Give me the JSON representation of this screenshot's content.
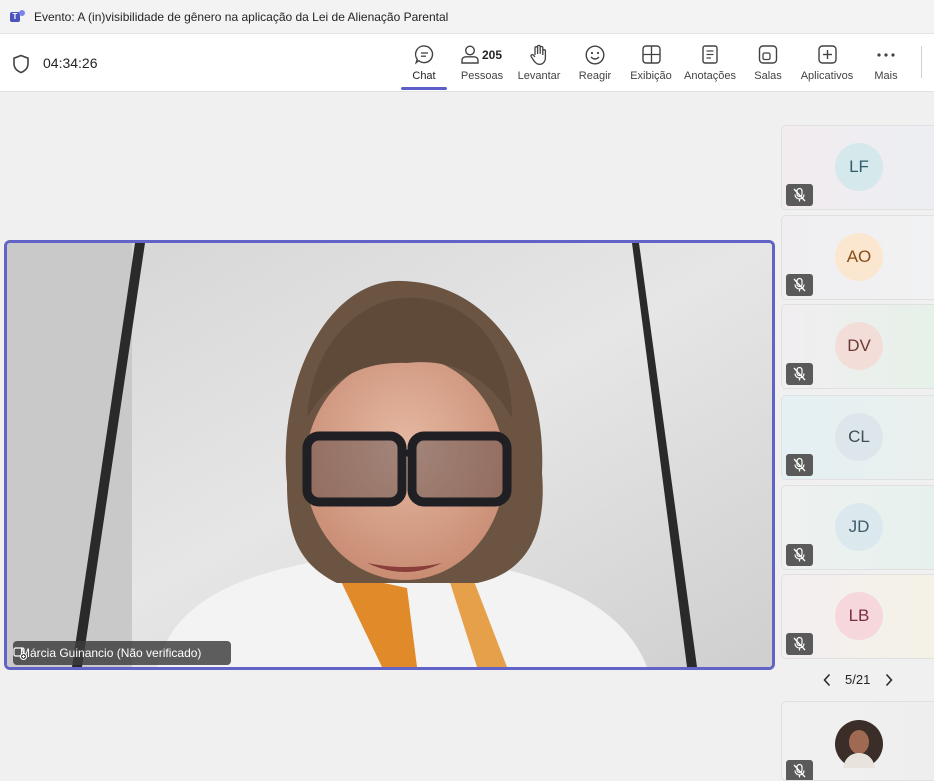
{
  "window": {
    "title": "Evento: A (in)visibilidade de gênero na aplicação da Lei de Alienação Parental"
  },
  "toolbar": {
    "timer": "04:34:26",
    "people_count": "205",
    "buttons": {
      "chat": "Chat",
      "people": "Pessoas",
      "raise": "Levantar",
      "react": "Reagir",
      "view": "Exibição",
      "notes": "Anotações",
      "rooms": "Salas",
      "apps": "Aplicativos",
      "more": "Mais"
    },
    "icons": [
      "shield-icon",
      "chat-icon",
      "people-icon",
      "hand-icon",
      "emoji-icon",
      "view-grid-icon",
      "notes-icon",
      "rooms-icon",
      "apps-plus-icon",
      "more-icon"
    ]
  },
  "main_video": {
    "speaker_name": "Márcia Guinancio (Não verificado)"
  },
  "participants": [
    {
      "initials": "LF",
      "avatar_bg": "#d5e8ec",
      "text_color": "#2f5d6b"
    },
    {
      "initials": "AO",
      "avatar_bg": "#fbe7cf",
      "text_color": "#8a4c16"
    },
    {
      "initials": "DV",
      "avatar_bg": "#f3ddd8",
      "text_color": "#6b3a33"
    },
    {
      "initials": "CL",
      "avatar_bg": "#dde6ea",
      "text_color": "#3d4e57"
    },
    {
      "initials": "JD",
      "avatar_bg": "#dbe9ee",
      "text_color": "#3f5b66"
    },
    {
      "initials": "LB",
      "avatar_bg": "#f5d7dc",
      "text_color": "#7b2e3e"
    }
  ],
  "pager": {
    "text": "5/21"
  },
  "colors": {
    "accent": "#5b5fc7",
    "active_border": "#6164c6"
  }
}
